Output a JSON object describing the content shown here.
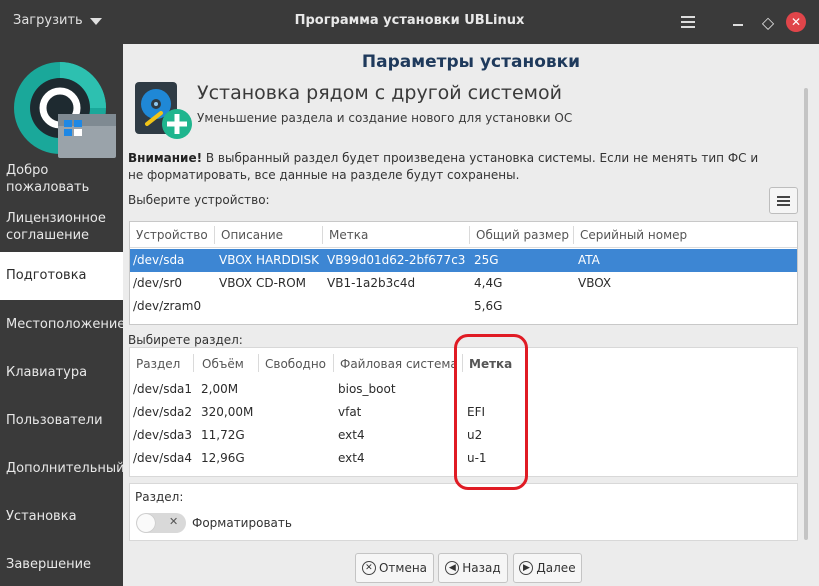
{
  "titlebar": {
    "menu_label": "Загрузить",
    "title": "Программа установки UBLinux",
    "close_glyph": "✕",
    "restore_glyph": "◇"
  },
  "sidebar": {
    "items": [
      {
        "label": "Добро пожаловать"
      },
      {
        "label": "Лицензионное соглашение"
      },
      {
        "label": "Подготовка"
      },
      {
        "label": "Местоположение"
      },
      {
        "label": "Клавиатура"
      },
      {
        "label": "Пользователи"
      },
      {
        "label": "Дополнительный"
      },
      {
        "label": "Установка"
      },
      {
        "label": "Завершение"
      }
    ],
    "active_index": 2
  },
  "main": {
    "page_title": "Параметры установки",
    "header": {
      "title": "Установка рядом с другой системой",
      "subtitle": "Уменьшение раздела и создание нового для установки ОС"
    },
    "warning_bold": "Внимание!",
    "warning_text": " В выбранный раздел будет произведена установка системы. Если не менять тип ФС и не форматировать, все данные на разделе будут сохранены.",
    "device_label": "Выберите устройство:",
    "device_table": {
      "headers": [
        "Устройство",
        "Описание",
        "Метка",
        "Общий размер",
        "Серийный номер"
      ],
      "rows": [
        [
          "/dev/sda",
          "VBOX HARDDISK",
          "VB99d01d62-2bf677c3",
          "25G",
          "ATA"
        ],
        [
          "/dev/sr0",
          "VBOX CD-ROM",
          "VB1-1a2b3c4d",
          "4,4G",
          "VBOX"
        ],
        [
          "/dev/zram0",
          "",
          "",
          "5,6G",
          ""
        ]
      ],
      "selected_row": 0
    },
    "partition_label": "Выбирете раздел:",
    "partition_table": {
      "headers": [
        "Раздел",
        "Объём",
        "Свободно",
        "Файловая система",
        "Метка"
      ],
      "rows": [
        [
          "/dev/sda1",
          "2,00M",
          "",
          "bios_boot",
          ""
        ],
        [
          "/dev/sda2",
          "320,00M",
          "",
          "vfat",
          "EFI"
        ],
        [
          "/dev/sda3",
          "11,72G",
          "",
          "ext4",
          "u2"
        ],
        [
          "/dev/sda4",
          "12,96G",
          "",
          "ext4",
          "u-1"
        ]
      ]
    },
    "partition_panel": {
      "label": "Раздел:",
      "format_label": "Форматировать",
      "format_enabled": false
    },
    "buttons": {
      "cancel": "Отмена",
      "back": "Назад",
      "next": "Далее"
    }
  },
  "colors": {
    "sidebar_bg": "#3a3a3a",
    "selection": "#3d86d3",
    "highlight": "#e01b24",
    "close_button": "#e0454a"
  }
}
